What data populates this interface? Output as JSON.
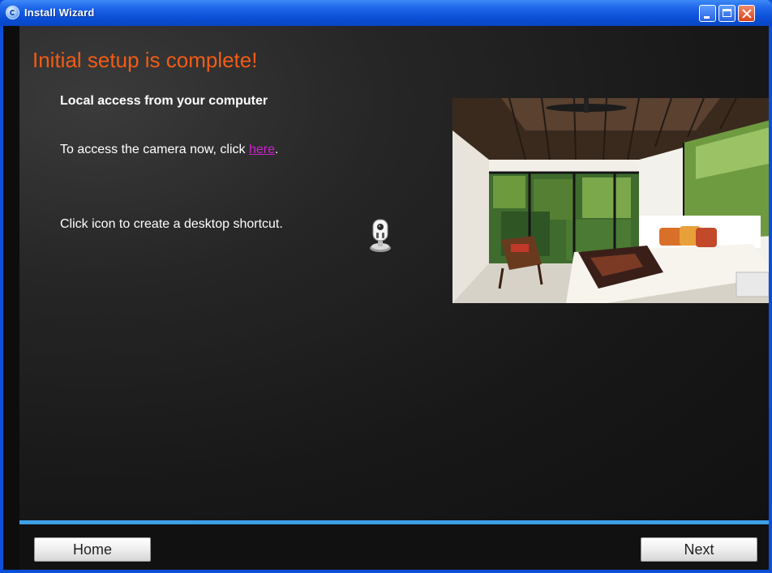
{
  "window": {
    "title": "Install Wizard",
    "controls": {
      "minimize": "minimize",
      "maximize": "maximize",
      "close": "close"
    }
  },
  "content": {
    "heading": "Initial setup is complete!",
    "subheading": "Local access from your computer",
    "access_prefix": "To access the camera now, click ",
    "access_link": "here",
    "access_suffix": ".",
    "shortcut_text": "Click icon to create a desktop shortcut."
  },
  "footer": {
    "home_label": "Home",
    "next_label": "Next"
  },
  "colors": {
    "heading": "#f25c14",
    "link": "#cc22cc",
    "accent_bar": "#3da0e6",
    "titlebar": "#0a4fd6"
  },
  "icons": {
    "title_icon": "app-logo-icon",
    "shortcut_icon": "camera-icon"
  }
}
